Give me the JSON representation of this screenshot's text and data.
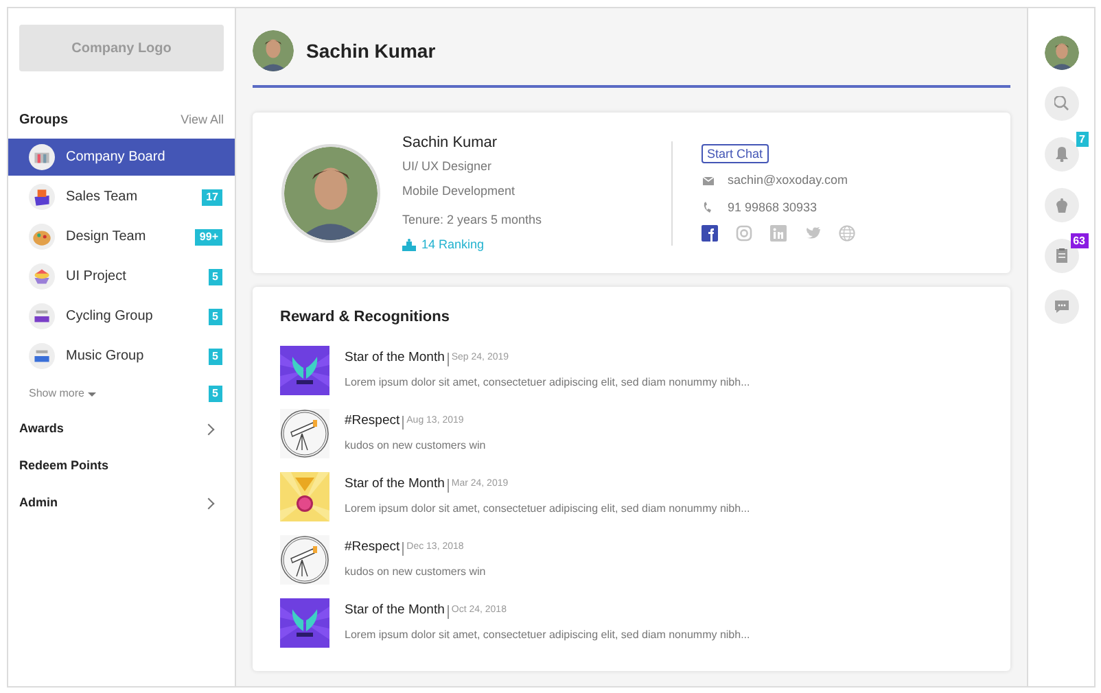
{
  "sidebar": {
    "logo": "Company Logo",
    "groups_title": "Groups",
    "view_all": "View All",
    "groups": [
      {
        "name": "Company Board",
        "selected": true
      },
      {
        "name": "Sales Team",
        "badge": "17",
        "selected": false
      },
      {
        "name": "Design Team",
        "badge": "99+",
        "selected": false
      },
      {
        "name": "UI Project",
        "badge": "5",
        "selected": false
      },
      {
        "name": "Cycling Group",
        "badge": "5",
        "selected": false
      },
      {
        "name": "Music Group",
        "badge": "5",
        "selected": false
      }
    ],
    "show_more": {
      "label": "Show more",
      "badge": "5"
    },
    "nav": [
      {
        "label": "Awards",
        "has_arrow": true
      },
      {
        "label": "Redeem Points",
        "has_arrow": false
      },
      {
        "label": "Admin",
        "has_arrow": true
      }
    ]
  },
  "header": {
    "name": "Sachin Kumar"
  },
  "profile": {
    "name": "Sachin Kumar",
    "role": "UI/ UX Designer",
    "department": "Mobile Development",
    "tenure": "Tenure: 2 years 5 months",
    "ranking": "14 Ranking",
    "chat_button": "Start Chat",
    "email": "sachin@xoxoday.com",
    "phone": "91 99868 30933",
    "social": [
      {
        "active": true
      },
      {
        "active": false
      },
      {
        "active": false
      },
      {
        "active": false
      },
      {
        "active": false
      }
    ]
  },
  "rewards": {
    "title": "Reward & Recognitions",
    "items": [
      {
        "title": "Star of the Month",
        "date": "Sep 24, 2019",
        "text": "Lorem ipsum dolor sit amet, consectetuer adipiscing elit, sed diam nonummy nibh..."
      },
      {
        "title": "#Respect",
        "date": "Aug 13, 2019",
        "text": "kudos on new customers win"
      },
      {
        "title": "Star of the Month",
        "date": "Mar 24, 2019",
        "text": "Lorem ipsum dolor sit amet, consectetuer adipiscing elit, sed diam nonummy nibh..."
      },
      {
        "title": "#Respect",
        "date": "Dec 13, 2018",
        "text": "kudos on new customers win"
      },
      {
        "title": "Star of the Month",
        "date": "Oct 24, 2018",
        "text": "Lorem ipsum dolor sit amet, consectetuer adipiscing elit, sed diam nonummy nibh..."
      }
    ]
  },
  "rail": {
    "notifications": {
      "badge": "7",
      "color": "#22bcd4"
    },
    "tasks": {
      "badge": "63",
      "color": "#8a1be2"
    }
  }
}
